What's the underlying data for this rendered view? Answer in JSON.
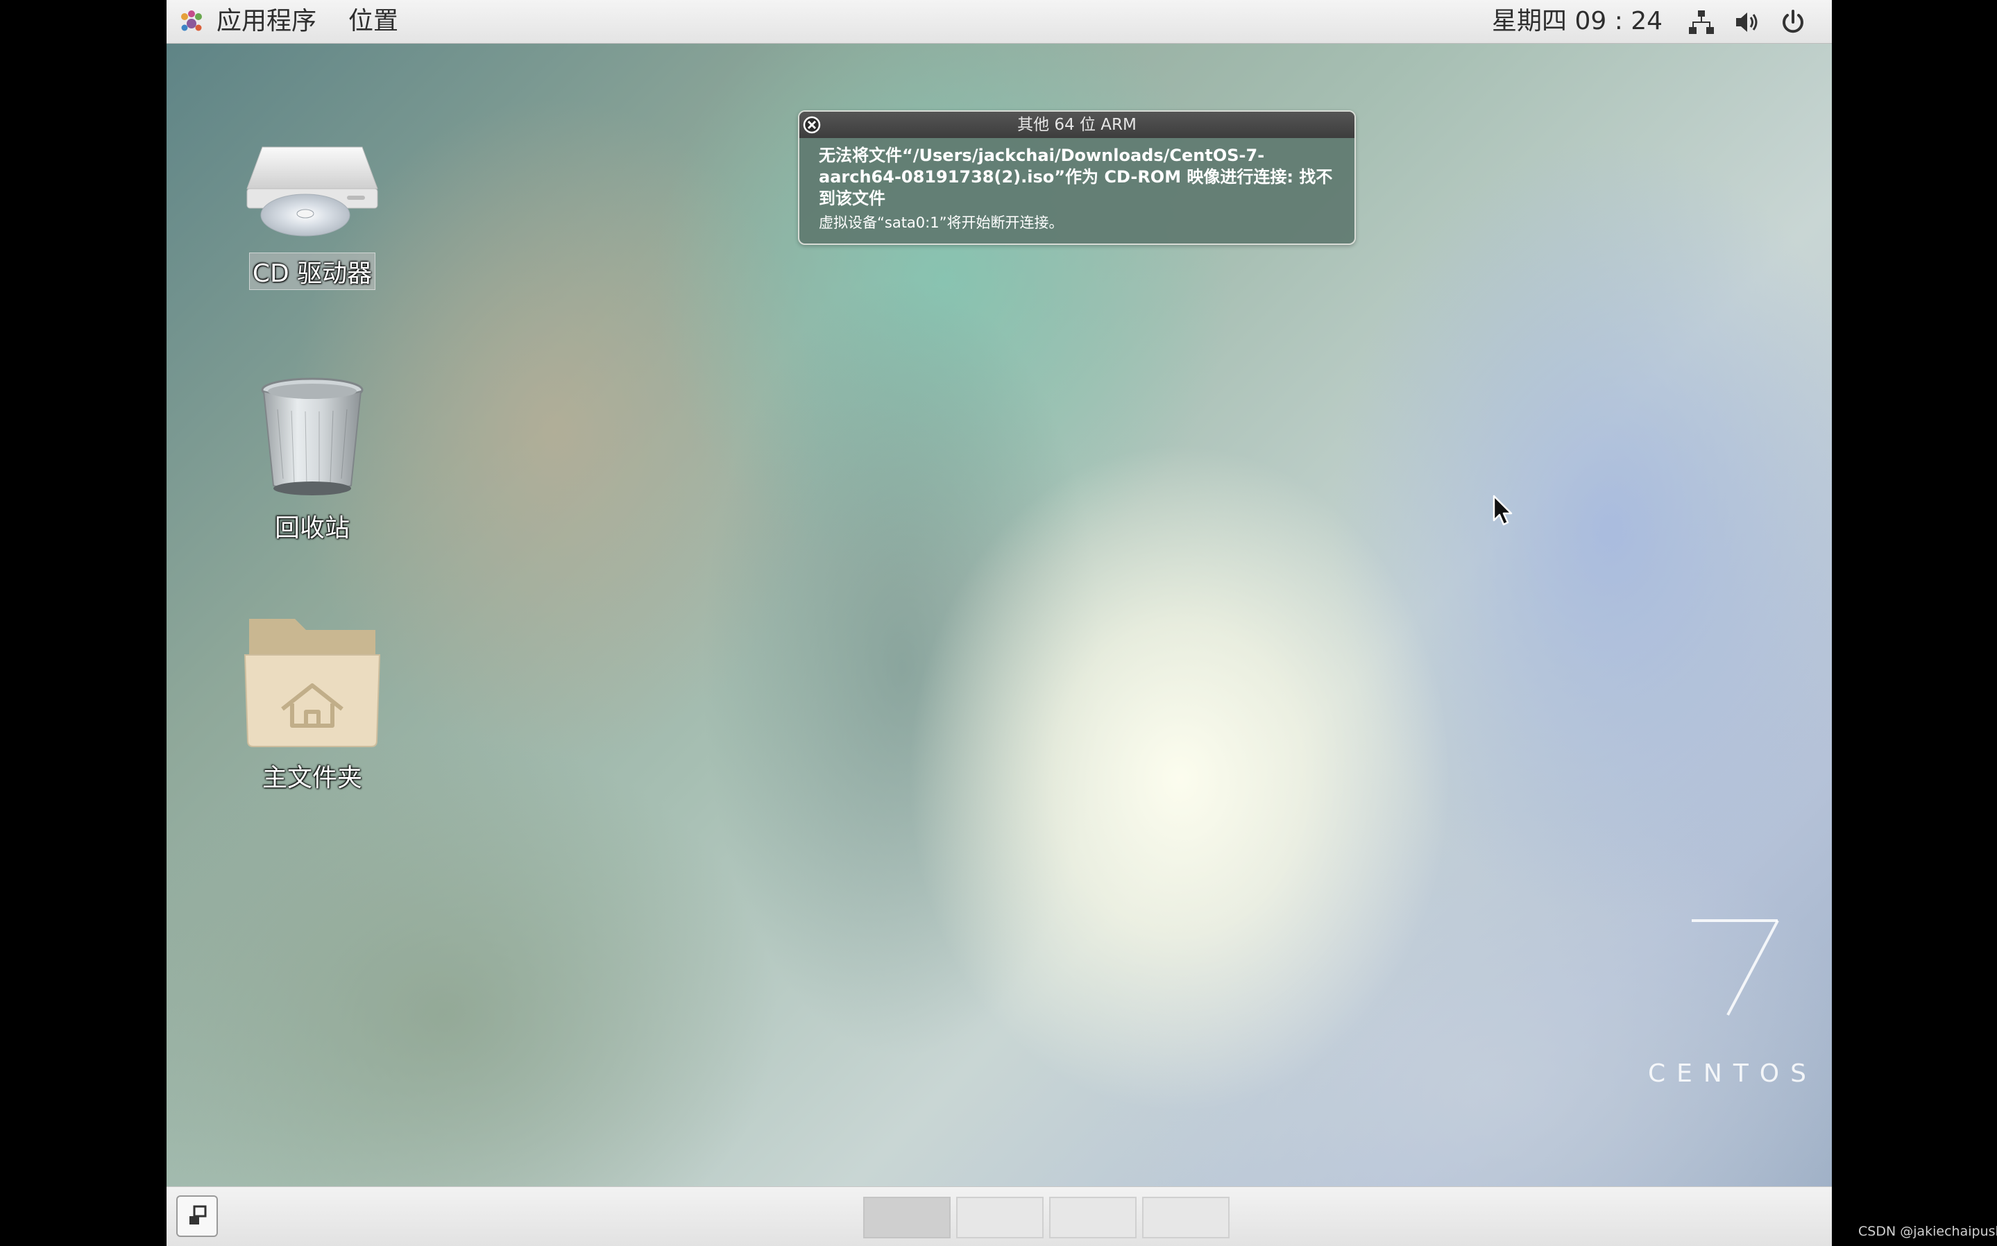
{
  "top_panel": {
    "applications_label": "应用程序",
    "places_label": "位置",
    "clock": "星期四 09 : 24",
    "tray_icons": [
      "network-icon",
      "volume-icon",
      "power-icon"
    ]
  },
  "notification": {
    "title": "其他 64 位 ARM",
    "message": "无法将文件“/Users/jackchai/Downloads/CentOS-7-aarch64-08191738(2).iso”作为 CD-ROM 映像进行连接: 找不到该文件",
    "detail": "虚拟设备“sata0:1”将开始断开连接。"
  },
  "desktop_icons": [
    {
      "label": "CD 驱动器",
      "icon": "cd-drive-icon",
      "selected": true
    },
    {
      "label": "回收站",
      "icon": "trash-icon",
      "selected": false
    },
    {
      "label": "主文件夹",
      "icon": "home-folder-icon",
      "selected": false
    }
  ],
  "branding": {
    "version": "7",
    "name": "CENTOS"
  },
  "bottom_panel": {
    "workspace_count": 4,
    "active_workspace": 1
  },
  "watermark": "CSDN @jakiechaipush",
  "colors": {
    "panel_bg": "#e8e8e8",
    "notification_bg": "#607a70",
    "notification_title_bg": "#484848"
  }
}
